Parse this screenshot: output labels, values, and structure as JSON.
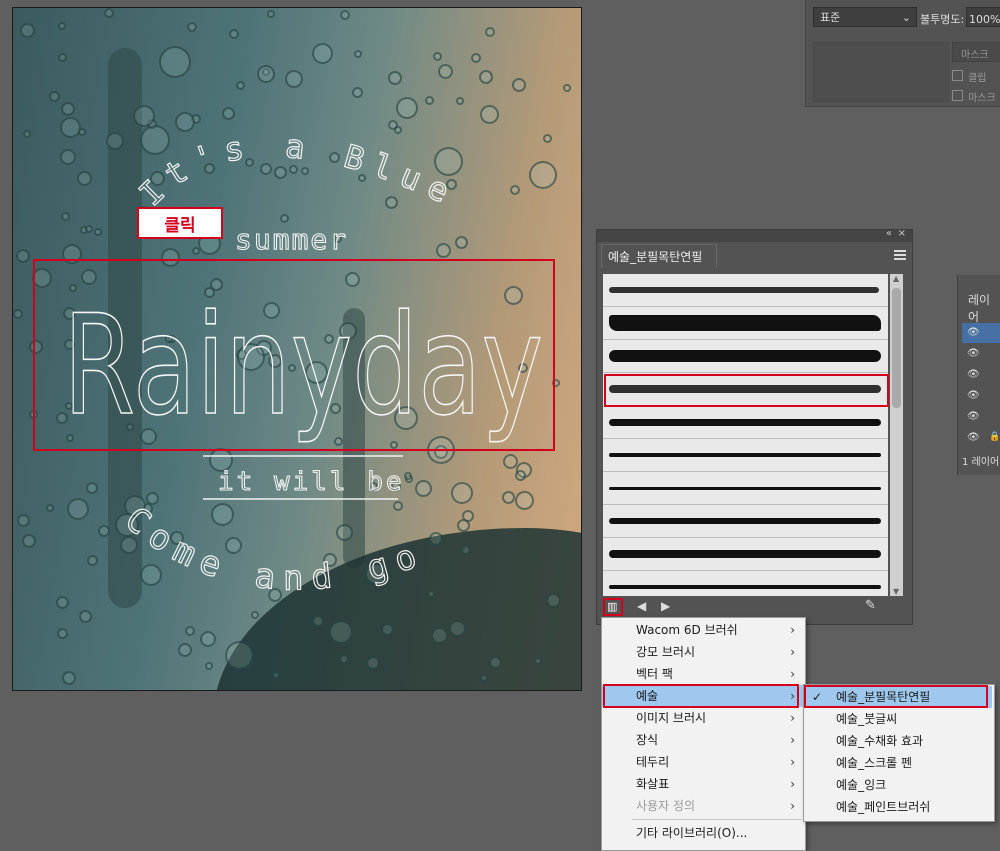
{
  "artboard": {
    "line1": "It's a Blue",
    "line2": "summer",
    "title": "Rainyday",
    "line3": "it will be",
    "line4": "Come and go",
    "click_label": "클릭"
  },
  "props_panel": {
    "blend_mode": "표준",
    "opacity_label": "불투명도:",
    "opacity_value": "100%",
    "mask_button": "마스크",
    "clip_label": "클립",
    "invert_mask_label": "마스크"
  },
  "brush_panel": {
    "tab_title": "예술_분필목탄연필",
    "collapse_icon": "double-chevron-icon",
    "close_icon": "close-icon",
    "menu_icon": "hamburger-icon",
    "brush_count": 10,
    "selected_index": 3
  },
  "layers_panel": {
    "title": "레이어",
    "footer": "1 레이어"
  },
  "library_menu": {
    "items": [
      {
        "label": "Wacom 6D 브러쉬",
        "submenu": true,
        "disabled": false
      },
      {
        "label": "강모 브러시",
        "submenu": true,
        "disabled": false
      },
      {
        "label": "벡터 팩",
        "submenu": true,
        "disabled": false
      },
      {
        "label": "예술",
        "submenu": true,
        "disabled": false,
        "highlighted": true
      },
      {
        "label": "이미지 브러시",
        "submenu": true,
        "disabled": false
      },
      {
        "label": "장식",
        "submenu": true,
        "disabled": false
      },
      {
        "label": "테두리",
        "submenu": true,
        "disabled": false
      },
      {
        "label": "화살표",
        "submenu": true,
        "disabled": false
      },
      {
        "label": "사용자 정의",
        "submenu": true,
        "disabled": true
      },
      {
        "label": "기타 라이브러리(O)...",
        "submenu": false,
        "disabled": false
      }
    ]
  },
  "art_submenu": {
    "items": [
      {
        "label": "예술_분필목탄연필",
        "checked": true
      },
      {
        "label": "예술_붓글씨",
        "checked": false
      },
      {
        "label": "예술_수채화 효과",
        "checked": false
      },
      {
        "label": "예술_스크롤 펜",
        "checked": false
      },
      {
        "label": "예술_잉크",
        "checked": false
      },
      {
        "label": "예술_페인트브러쉬",
        "checked": false
      }
    ]
  },
  "colors": {
    "highlight": "#9fc8ef",
    "annotation_red": "#d2001c",
    "ui_panel": "#535353"
  }
}
